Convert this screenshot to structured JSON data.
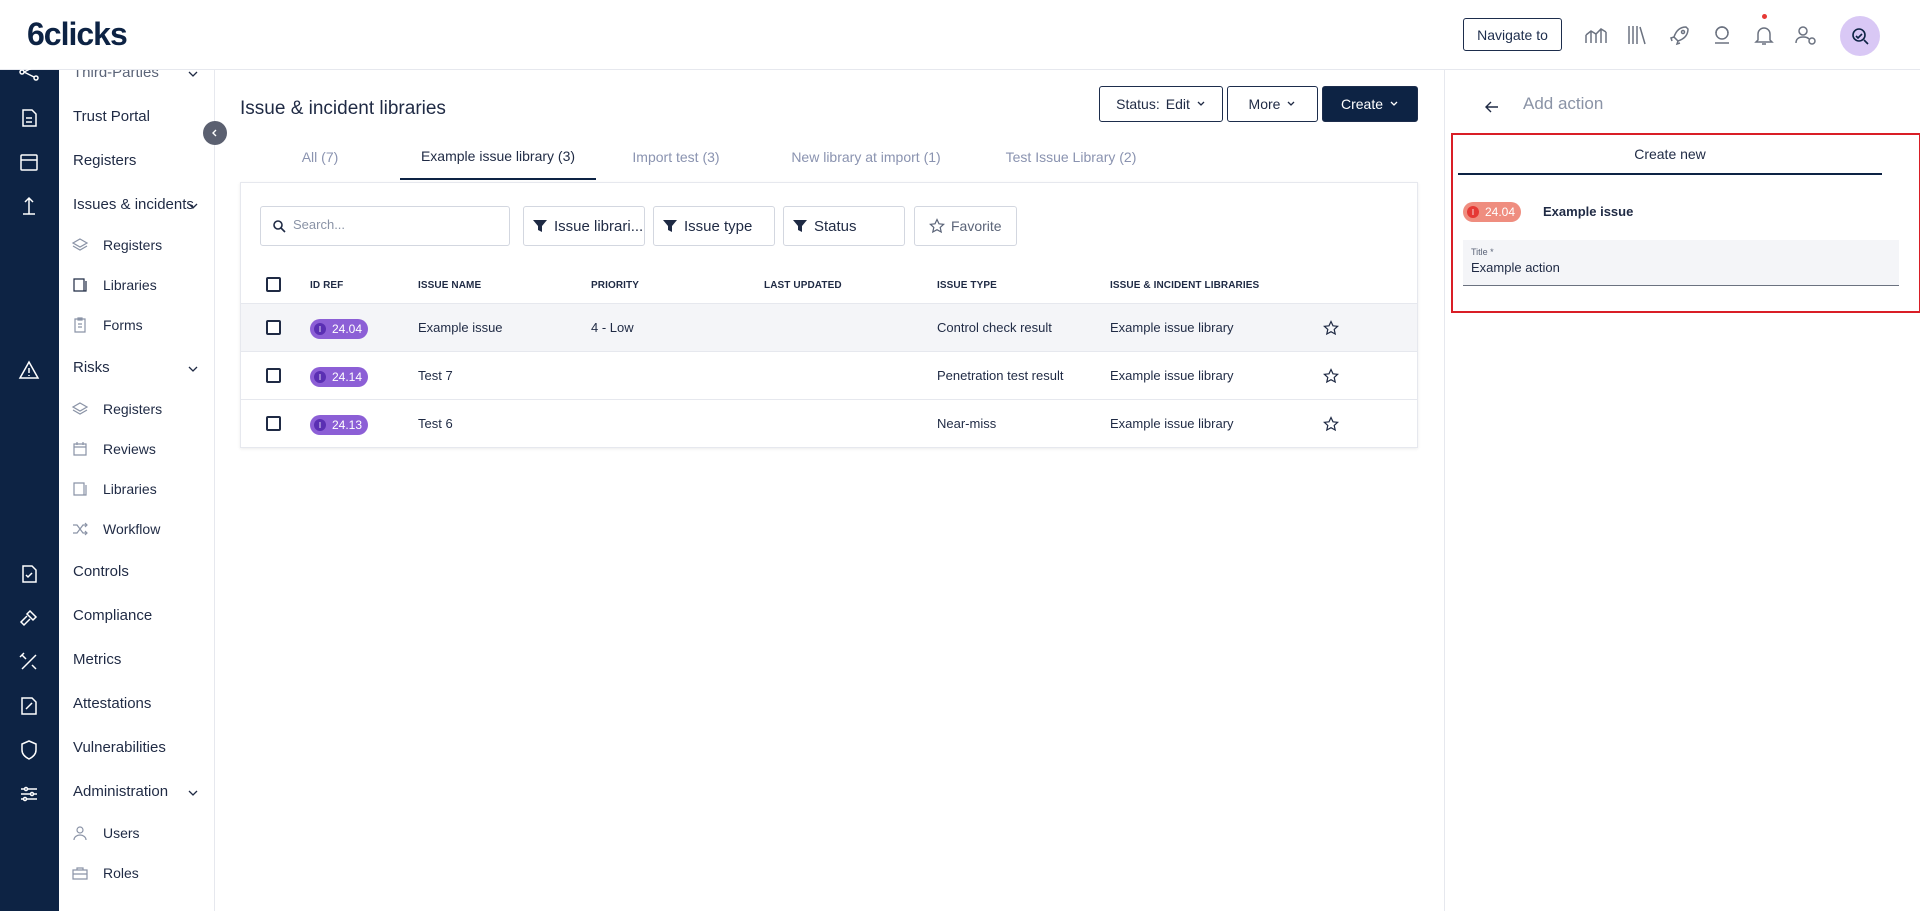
{
  "app": {
    "logo": "6clicks"
  },
  "topbar": {
    "navigate_label": "Navigate to"
  },
  "sidebar": {
    "cut_item": "Third-Parties",
    "trust_portal": "Trust Portal",
    "registers": "Registers",
    "issues": {
      "label": "Issues & incidents",
      "sub": [
        "Registers",
        "Libraries",
        "Forms"
      ]
    },
    "risks": {
      "label": "Risks",
      "sub": [
        "Registers",
        "Reviews",
        "Libraries",
        "Workflow"
      ]
    },
    "controls": "Controls",
    "compliance": "Compliance",
    "metrics": "Metrics",
    "attestations": "Attestations",
    "vulnerabilities": "Vulnerabilities",
    "administration": {
      "label": "Administration",
      "sub": [
        "Users",
        "Roles"
      ]
    }
  },
  "page": {
    "title": "Issue & incident libraries",
    "status_prefix": "Status:",
    "status_value": "Edit",
    "more_label": "More",
    "create_label": "Create"
  },
  "tabs": [
    "All (7)",
    "Example issue library (3)",
    "Import test (3)",
    "New library at import (1)",
    "Test Issue Library (2)"
  ],
  "filters": {
    "search_placeholder": "Search...",
    "issue_libraries": "Issue librari...",
    "issue_type": "Issue type",
    "status": "Status",
    "favorite": "Favorite"
  },
  "table": {
    "headers": [
      "ID REF",
      "ISSUE NAME",
      "PRIORITY",
      "LAST UPDATED",
      "ISSUE TYPE",
      "ISSUE & INCIDENT LIBRARIES"
    ],
    "rows": [
      {
        "id": "24.04",
        "name": "Example issue",
        "priority": "4 - Low",
        "updated": "",
        "type": "Control check result",
        "library": "Example issue library"
      },
      {
        "id": "24.14",
        "name": "Test 7",
        "priority": "",
        "updated": "",
        "type": "Penetration test result",
        "library": "Example issue library"
      },
      {
        "id": "24.13",
        "name": "Test 6",
        "priority": "",
        "updated": "",
        "type": "Near-miss",
        "library": "Example issue library"
      }
    ]
  },
  "panel": {
    "title": "Add action",
    "tab": "Create new",
    "issue_id": "24.04",
    "issue_name": "Example issue",
    "field_label": "Title *",
    "field_value": "Example action"
  },
  "colors": {
    "brand_navy": "#0d2344",
    "badge_purple": "#8c5fd6",
    "badge_red": "#ef8d7f",
    "highlight_red": "#d91e26"
  }
}
